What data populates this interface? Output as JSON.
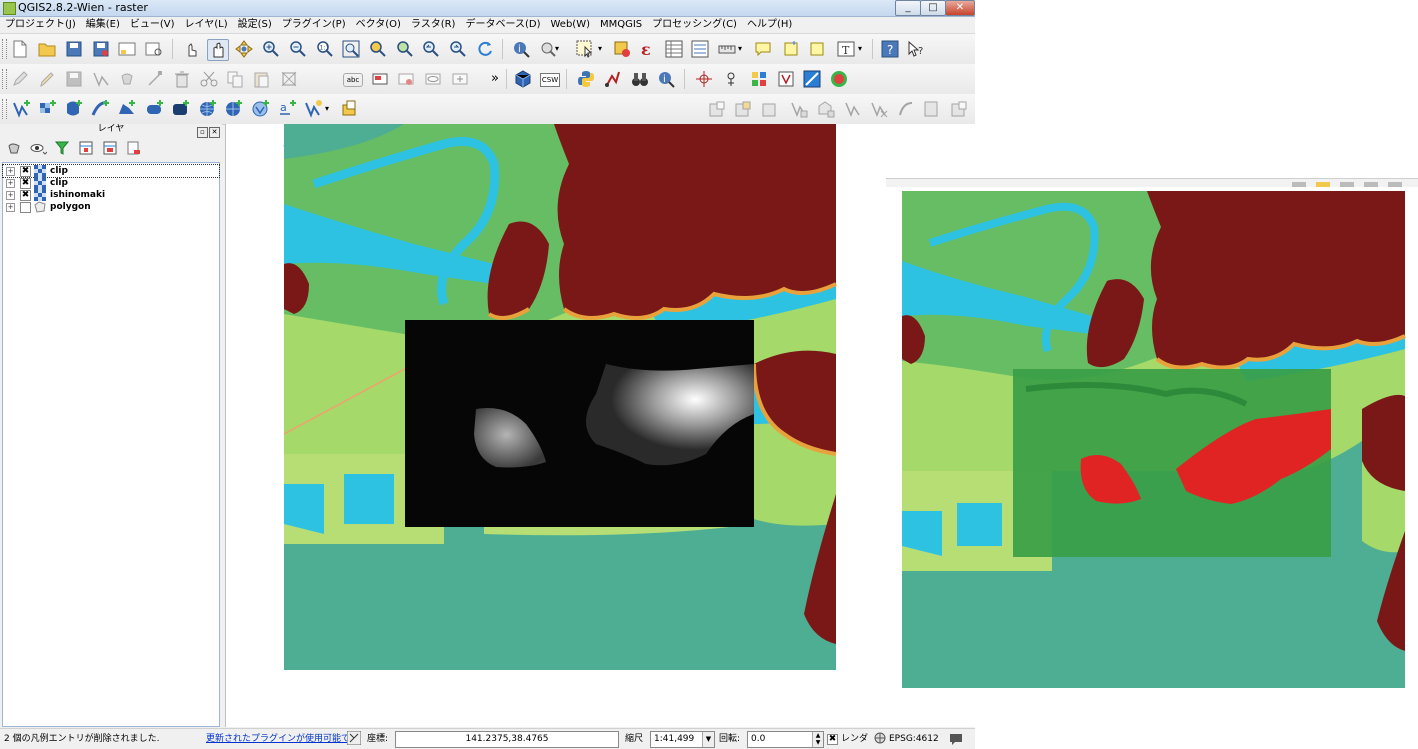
{
  "window": {
    "title": "QGIS2.8.2-Wien - raster",
    "minimize": "_",
    "maximize": "□",
    "close": "✕"
  },
  "menu": [
    "プロジェクト(J)",
    "編集(E)",
    "ビュー(V)",
    "レイヤ(L)",
    "設定(S)",
    "プラグイン(P)",
    "ベクタ(O)",
    "ラスタ(R)",
    "データベース(D)",
    "Web(W)",
    "MMQGIS",
    "プロセッシング(C)",
    "ヘルプ(H)"
  ],
  "toolbar_text": {
    "more": "»",
    "abc": "abc",
    "csw": "CSW"
  },
  "layers_panel": {
    "title": "レイヤ",
    "float_btn": "▫",
    "close_btn": "✕",
    "layers": [
      {
        "name": "clip",
        "checked": true,
        "kind": "raster"
      },
      {
        "name": "clip",
        "checked": true,
        "kind": "raster"
      },
      {
        "name": "ishinomaki",
        "checked": true,
        "kind": "raster"
      },
      {
        "name": "polygon",
        "checked": false,
        "kind": "polygon"
      }
    ]
  },
  "statusbar": {
    "message": "2 個の凡例エントリが削除されました.",
    "plugin_link": "更新されたプラグインが使用可能です",
    "coord_label": "座標:",
    "coord_value": "141.2375,38.4765",
    "scale_label": "縮尺",
    "scale_value": "1:41,499",
    "rotation_label": "回転:",
    "rotation_value": "0.0",
    "render_label": "レンダ",
    "crs": "EPSG:4612"
  },
  "colors": {
    "sea": "#4dae93",
    "dark_red": "#7a1717",
    "cyan_water": "#2ec2e2",
    "yellow_green": "#c7e55e",
    "green": "#3ab54a",
    "bright_red": "#e02424",
    "title_bar": "#c4d8ef"
  }
}
